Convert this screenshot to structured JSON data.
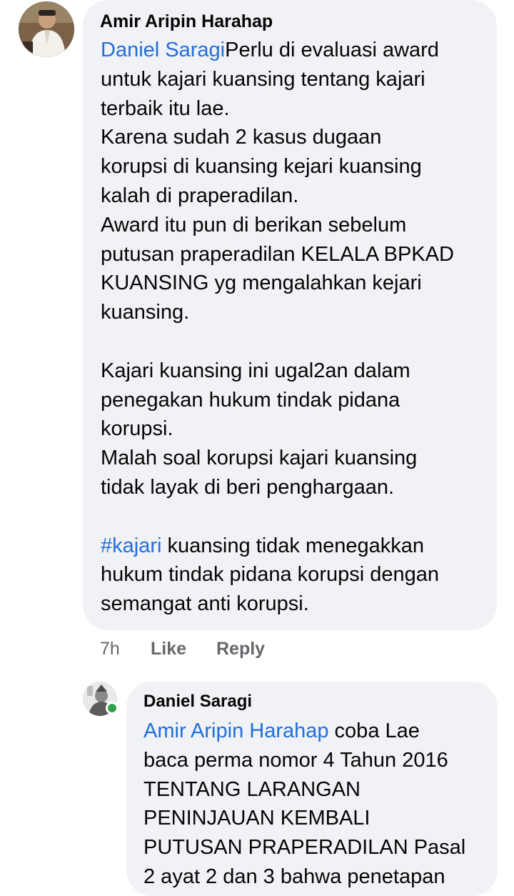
{
  "comment": {
    "author": "Amir Aripin Harahap",
    "avatar_icon": "user-profile-photo-icon",
    "mention": "Daniel Saragi",
    "text": "Perlu di evaluasi award\nuntuk kajari kuansing tentang kajari\nterbaik itu lae.\nKarena sudah 2 kasus dugaan\nkorupsi di kuansing kejari kuansing\nkalah di praperadilan.\nAward itu pun di berikan sebelum\nputusan praperadilan KELALA BPKAD\nKUANSING yg mengalahkan kejari\nkuansing.\n\nKajari kuansing ini ugal2an dalam\npenegakan hukum tindak pidana\nkorupsi.\nMalah soal korupsi kajari kuansing\ntidak layak di beri penghargaan.\n\n",
    "hashtag": "#kajari",
    "text_tail": " kuansing tidak menegakkan\nhukum tindak pidana korupsi dengan\nsemangat anti korupsi.",
    "time": "7h",
    "like_label": "Like",
    "reply_label": "Reply"
  },
  "reply": {
    "author": "Daniel Saragi",
    "avatar_icon": "user-profile-photo-icon",
    "online_status_color": "#31a24c",
    "mention": "Amir Aripin Harahap",
    "text": " coba Lae\nbaca perma nomor 4 Tahun 2016\nTENTANG LARANGAN\nPENINJAUAN KEMBALI\nPUTUSAN PRAPERADILAN Pasal\n2 ayat 2 dan 3 bahwa penetapan"
  },
  "colors": {
    "bubble_bg": "#f0f2f5",
    "mention": "#216fdb",
    "meta_text": "#65676b"
  }
}
